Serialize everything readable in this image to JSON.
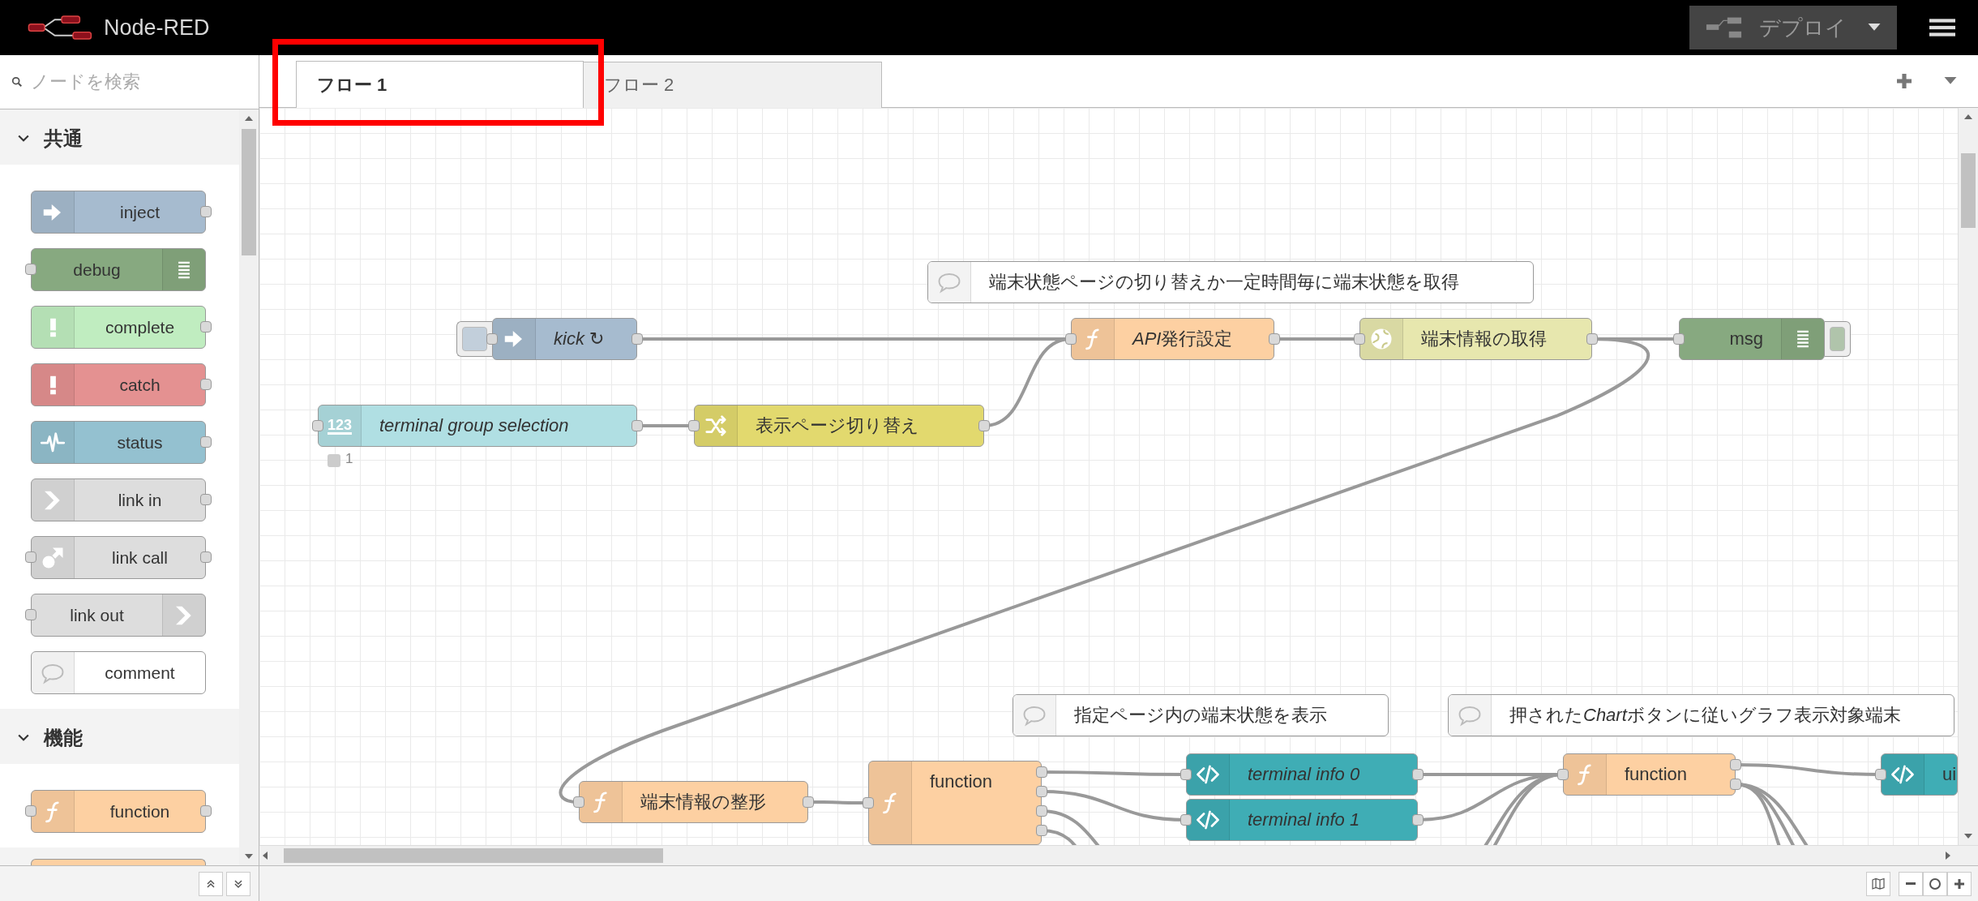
{
  "header": {
    "title": "Node-RED",
    "deploy": {
      "label": "デプロイ",
      "disabled": true
    }
  },
  "palette": {
    "search": {
      "placeholder": "ノードを検索"
    },
    "categories": [
      {
        "label": "共通",
        "expanded": true,
        "nodes": [
          {
            "label": "inject",
            "kind": "arrow",
            "color": "#a6bbcf",
            "input": false,
            "output": true
          },
          {
            "label": "debug",
            "kind": "list",
            "color": "#87a980",
            "input": true,
            "output": false
          },
          {
            "label": "complete",
            "kind": "exclaim",
            "color": "#c0edc0",
            "input": false,
            "output": true
          },
          {
            "label": "catch",
            "kind": "exclaim",
            "color": "#e49191",
            "input": false,
            "output": true
          },
          {
            "label": "status",
            "kind": "pulse",
            "color": "#94c1d0",
            "input": false,
            "output": true
          },
          {
            "label": "link in",
            "kind": "linkin",
            "color": "#dddddd",
            "input": false,
            "output": true
          },
          {
            "label": "link call",
            "kind": "linkcall",
            "color": "#dddddd",
            "input": true,
            "output": true
          },
          {
            "label": "link out",
            "kind": "linkout",
            "color": "#dddddd",
            "input": true,
            "output": false
          },
          {
            "label": "comment",
            "kind": "bubble",
            "color": "#ffffff",
            "input": false,
            "output": false
          }
        ]
      },
      {
        "label": "機能",
        "expanded": true,
        "nodes": [
          {
            "label": "function",
            "kind": "function",
            "color": "#fdd0a2",
            "input": true,
            "output": true
          }
        ]
      }
    ]
  },
  "tabs": [
    {
      "label": "フロー 1",
      "selected": true,
      "highlighted": true
    },
    {
      "label": "フロー 2",
      "selected": false,
      "highlighted": false
    }
  ],
  "canvas": {
    "comments": [
      {
        "parts": [
          {
            "text": "端末状態ページの切り替えか一定時間毎に端末状態を取得",
            "italic": false
          }
        ]
      },
      {
        "parts": [
          {
            "text": "指定ページ内の端末状態を表示",
            "italic": false
          }
        ]
      },
      {
        "parts": [
          {
            "text": "押された",
            "italic": false
          },
          {
            "text": "Chart",
            "italic": true
          },
          {
            "text": "ボタンに従いグラフ表示対象端末",
            "italic": false
          }
        ]
      }
    ],
    "nodes": [
      {
        "parts": [
          {
            "text": "kick ↻",
            "italic": true
          }
        ],
        "kind": "arrow",
        "color": "#a6bbcf",
        "button": true
      },
      {
        "parts": [
          {
            "text": "API",
            "italic": true
          },
          {
            "text": "発行設定",
            "italic": false
          }
        ],
        "kind": "function",
        "color": "#fdd0a2",
        "button": false
      },
      {
        "parts": [
          {
            "text": "端末情報の取得",
            "italic": false
          }
        ],
        "kind": "globe",
        "color": "#e7e7ae",
        "button": false
      },
      {
        "parts": [
          {
            "text": "msg",
            "italic": false
          }
        ],
        "kind": "list",
        "color": "#87a980",
        "button": true
      },
      {
        "parts": [
          {
            "text": "terminal group selection",
            "italic": true
          }
        ],
        "kind": "numeric",
        "icon_text": "123",
        "color": "#b0dfe3",
        "button": false,
        "status": "1"
      },
      {
        "parts": [
          {
            "text": "表示ページ切り替え",
            "italic": false
          }
        ],
        "kind": "shuffle",
        "color": "#e2d96e",
        "button": false
      },
      {
        "parts": [
          {
            "text": "端末情報の整形",
            "italic": false
          }
        ],
        "kind": "function",
        "color": "#fdd0a2",
        "button": false
      },
      {
        "parts": [
          {
            "text": "function",
            "italic": false
          }
        ],
        "kind": "function",
        "color": "#fdd0a2",
        "button": false
      },
      {
        "parts": [
          {
            "text": "terminal info 0",
            "italic": true
          }
        ],
        "kind": "code",
        "color": "#3fadb5",
        "button": false
      },
      {
        "parts": [
          {
            "text": "terminal info 1",
            "italic": true
          }
        ],
        "kind": "code",
        "color": "#3fadb5",
        "button": false
      },
      {
        "parts": [
          {
            "text": "function",
            "italic": false
          }
        ],
        "kind": "function",
        "color": "#fdd0a2",
        "button": false
      },
      {
        "parts": [
          {
            "text": "ui",
            "italic": false
          }
        ],
        "kind": "code",
        "color": "#3fadb5",
        "button": false
      }
    ]
  }
}
